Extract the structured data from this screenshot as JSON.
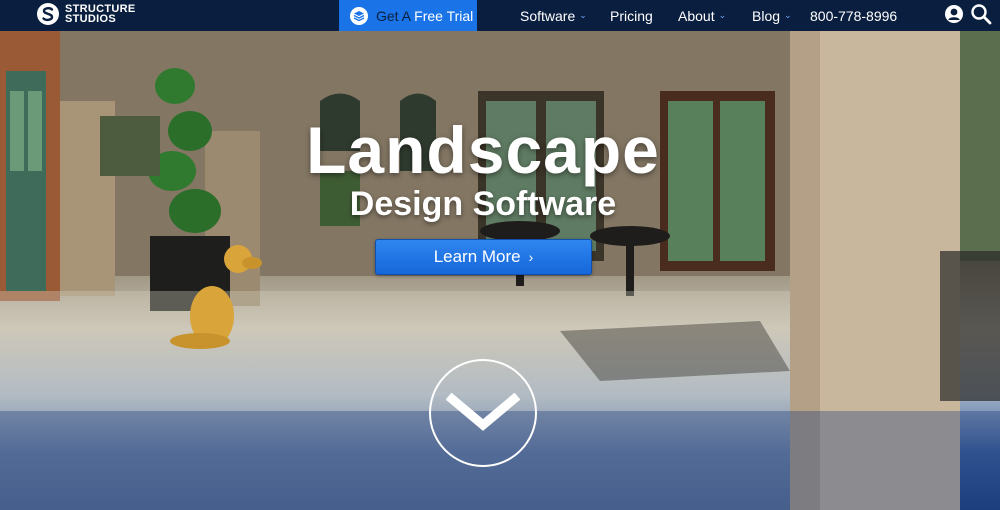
{
  "brand": {
    "line1": "STRUCTURE",
    "line2": "STUDIOS",
    "logo_icon": "structure-studios-s-logo"
  },
  "nav": {
    "trial_prefix": "Get A",
    "trial_label": "Free Trial",
    "trial_icon": "bundle-box-icon",
    "software": "Software",
    "pricing": "Pricing",
    "about": "About",
    "blog": "Blog",
    "phone": "800-778-8996",
    "dropdown_glyph": "⌄",
    "account_icon": "user-account-icon",
    "search_icon": "search-icon"
  },
  "hero": {
    "title": "Landscape",
    "subtitle": "Design Software",
    "cta_label": "Learn More",
    "cta_glyph": "›",
    "scroll_icon": "chevron-down-icon"
  },
  "colors": {
    "nav_bg": "#0a1f3f",
    "accent": "#1a74e8",
    "cta": "#1d6fe0",
    "text": "#ffffff"
  }
}
